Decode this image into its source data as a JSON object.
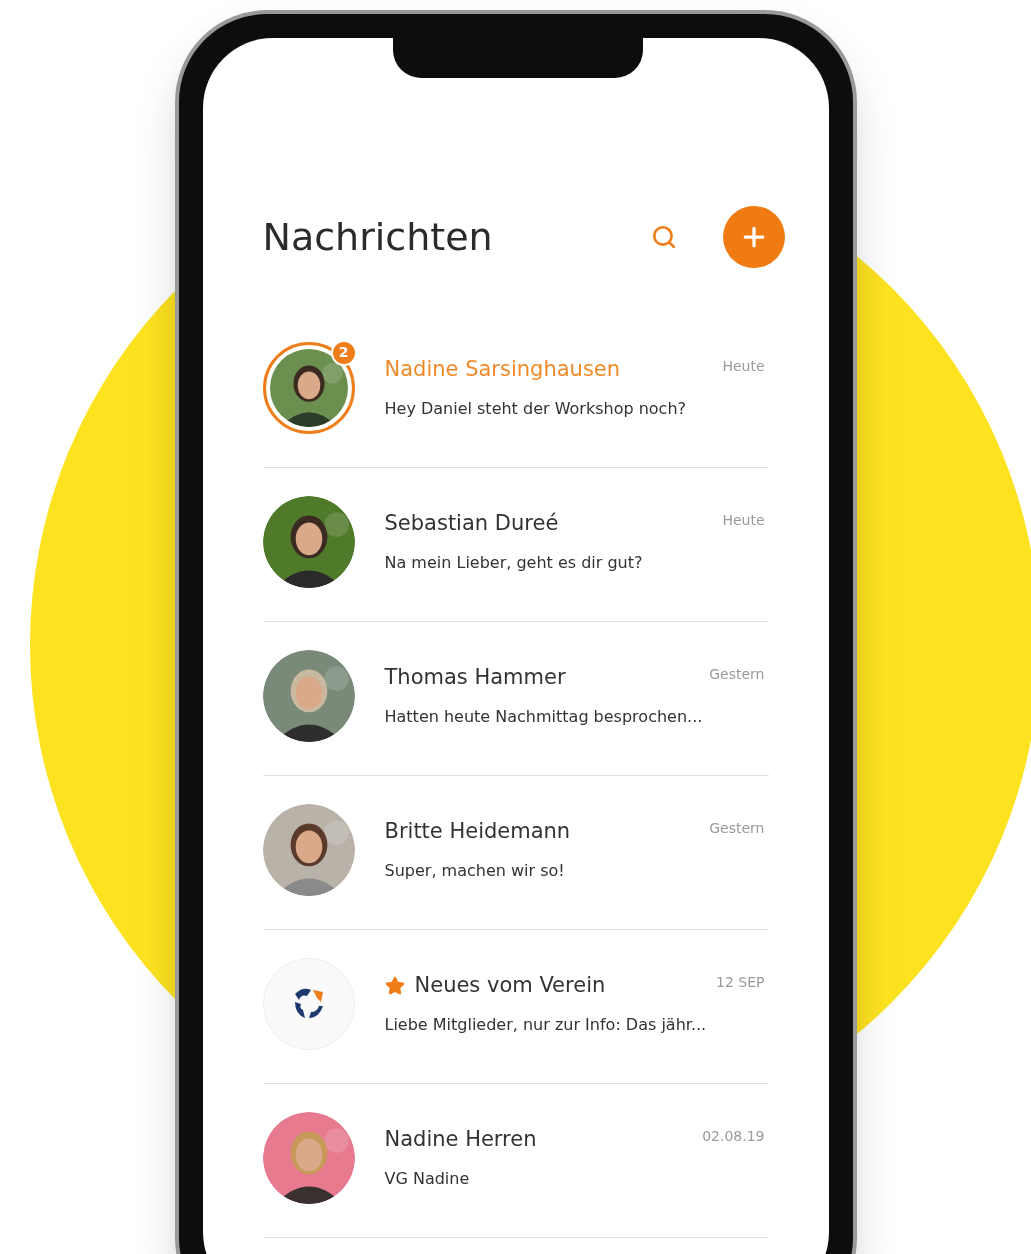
{
  "header": {
    "title": "Nachrichten"
  },
  "conversations": [
    {
      "name": "Nadine Sarsinghausen",
      "time": "Heute",
      "preview": "Hey Daniel steht der Workshop noch?",
      "unread": true,
      "badge": "2",
      "starred": false,
      "kind": "picture"
    },
    {
      "name": "Sebastian Dureé",
      "time": "Heute",
      "preview": "Na mein Lieber, geht es dir gut?",
      "unread": false,
      "starred": false,
      "kind": "picture"
    },
    {
      "name": "Thomas Hammer",
      "time": "Gestern",
      "preview": "Hatten heute Nachmittag besprochen...",
      "unread": false,
      "starred": false,
      "kind": "picture"
    },
    {
      "name": "Britte Heidemann",
      "time": "Gestern",
      "preview": "Super, machen wir so!",
      "unread": false,
      "starred": false,
      "kind": "picture"
    },
    {
      "name": "Neues vom Verein",
      "time": "12 SEP",
      "preview": "Liebe Mitglieder, nur zur Info: Das jähr...",
      "unread": false,
      "starred": true,
      "kind": "logo"
    },
    {
      "name": "Nadine Herren",
      "time": "02.08.19",
      "preview": "VG Nadine",
      "unread": false,
      "starred": false,
      "kind": "picture"
    }
  ]
}
